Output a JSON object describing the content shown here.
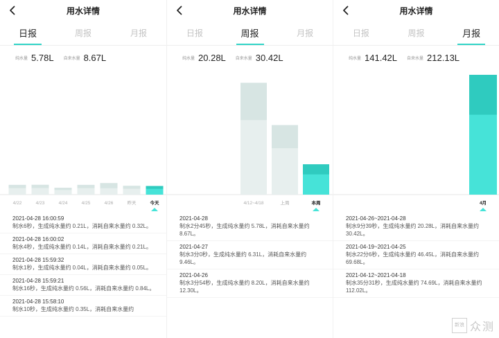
{
  "colors": {
    "accent": "#2ed3c6",
    "bar_pure": "#46e3d8",
    "bar_tap": "#2fcbbf",
    "bar_pure_gray": "#e7efee",
    "bar_tap_gray": "#d7e5e3",
    "axis_line": "#e6e6e6",
    "tick_text": "#aaaaaa"
  },
  "icons": {
    "back": "chevron-left-icon"
  },
  "screens": [
    {
      "title": "用水详情",
      "tabs": [
        {
          "label": "日报",
          "active": true
        },
        {
          "label": "周报",
          "active": false
        },
        {
          "label": "月报",
          "active": false
        }
      ],
      "summary": {
        "pure_label": "纯水量",
        "pure_value": "5.78L",
        "tap_label": "自来水量",
        "tap_value": "8.67L"
      },
      "chart_data": {
        "type": "bar",
        "stacked": true,
        "categories": [
          "4/22",
          "4/23",
          "4/24",
          "4/25",
          "4/26",
          "昨天",
          "今天"
        ],
        "selected_index": 6,
        "series": [
          {
            "name": "纯水量",
            "values": [
              6.5,
              6.6,
              4.6,
              6.5,
              6.4,
              5.9,
              5.78
            ]
          },
          {
            "name": "自来水量",
            "values": [
              9.8,
              9.9,
              6.9,
              9.8,
              11.6,
              8.9,
              8.67
            ]
          }
        ],
        "ylim": [
          0,
          120
        ]
      },
      "records": [
        {
          "date": "2021-04-28 16:00:59",
          "desc": "制水6秒，生成纯水量约 0.21L，消耗自来水量约 0.32L。"
        },
        {
          "date": "2021-04-28 16:00:02",
          "desc": "制水4秒，生成纯水量约 0.14L，消耗自来水量约 0.21L。"
        },
        {
          "date": "2021-04-28 15:59:32",
          "desc": "制水1秒，生成纯水量约 0.04L，消耗自来水量约 0.05L。"
        },
        {
          "date": "2021-04-28 15:59:21",
          "desc": "制水16秒，生成纯水量约 0.56L，消耗自来水量约 0.84L。"
        },
        {
          "date": "2021-04-28 15:58:10",
          "desc": "制水10秒，生成纯水量约 0.35L，消耗自来水量约"
        }
      ]
    },
    {
      "title": "用水详情",
      "tabs": [
        {
          "label": "日报",
          "active": false
        },
        {
          "label": "周报",
          "active": true
        },
        {
          "label": "月报",
          "active": false
        }
      ],
      "summary": {
        "pure_label": "纯水量",
        "pure_value": "20.28L",
        "tap_label": "自来水量",
        "tap_value": "30.42L"
      },
      "chart_data": {
        "type": "bar",
        "stacked": true,
        "categories": [
          "4/12~4/18",
          "上周",
          "本周"
        ],
        "selected_index": 2,
        "series": [
          {
            "name": "纯水量",
            "values": [
              74.69,
              46.45,
              20.28
            ]
          },
          {
            "name": "自来水量",
            "values": [
              112.02,
              69.68,
              30.42
            ]
          }
        ],
        "ylim": [
          0,
          120
        ]
      },
      "records": [
        {
          "date": "2021-04-28",
          "desc": "制水2分45秒，生成纯水量约 5.78L，消耗自来水量约 8.67L。"
        },
        {
          "date": "2021-04-27",
          "desc": "制水3分0秒，生成纯水量约 6.31L，消耗自来水量约 9.46L。"
        },
        {
          "date": "2021-04-26",
          "desc": "制水3分54秒，生成纯水量约 8.20L，消耗自来水量约 12.30L。"
        }
      ]
    },
    {
      "title": "用水详情",
      "tabs": [
        {
          "label": "日报",
          "active": false
        },
        {
          "label": "周报",
          "active": false
        },
        {
          "label": "月报",
          "active": true
        }
      ],
      "summary": {
        "pure_label": "纯水量",
        "pure_value": "141.42L",
        "tap_label": "自来水量",
        "tap_value": "212.13L"
      },
      "chart_data": {
        "type": "bar",
        "stacked": true,
        "categories": [
          "4月"
        ],
        "selected_index": 0,
        "series": [
          {
            "name": "纯水量",
            "values": [
              141.42
            ]
          },
          {
            "name": "自来水量",
            "values": [
              212.13
            ]
          }
        ],
        "ylim": [
          0,
          212.13
        ]
      },
      "records": [
        {
          "date": "2021-04-26~2021-04-28",
          "desc": "制水9分39秒，生成纯水量约 20.28L，消耗自来水量约 30.42L。"
        },
        {
          "date": "2021-04-19~2021-04-25",
          "desc": "制水22分6秒，生成纯水量约 46.45L，消耗自来水量约 69.68L。"
        },
        {
          "date": "2021-04-12~2021-04-18",
          "desc": "制水35分31秒，生成纯水量约 74.69L，消耗自来水量约 112.02L。"
        }
      ]
    }
  ],
  "watermark": {
    "seal": "新浪",
    "text": "众测"
  }
}
